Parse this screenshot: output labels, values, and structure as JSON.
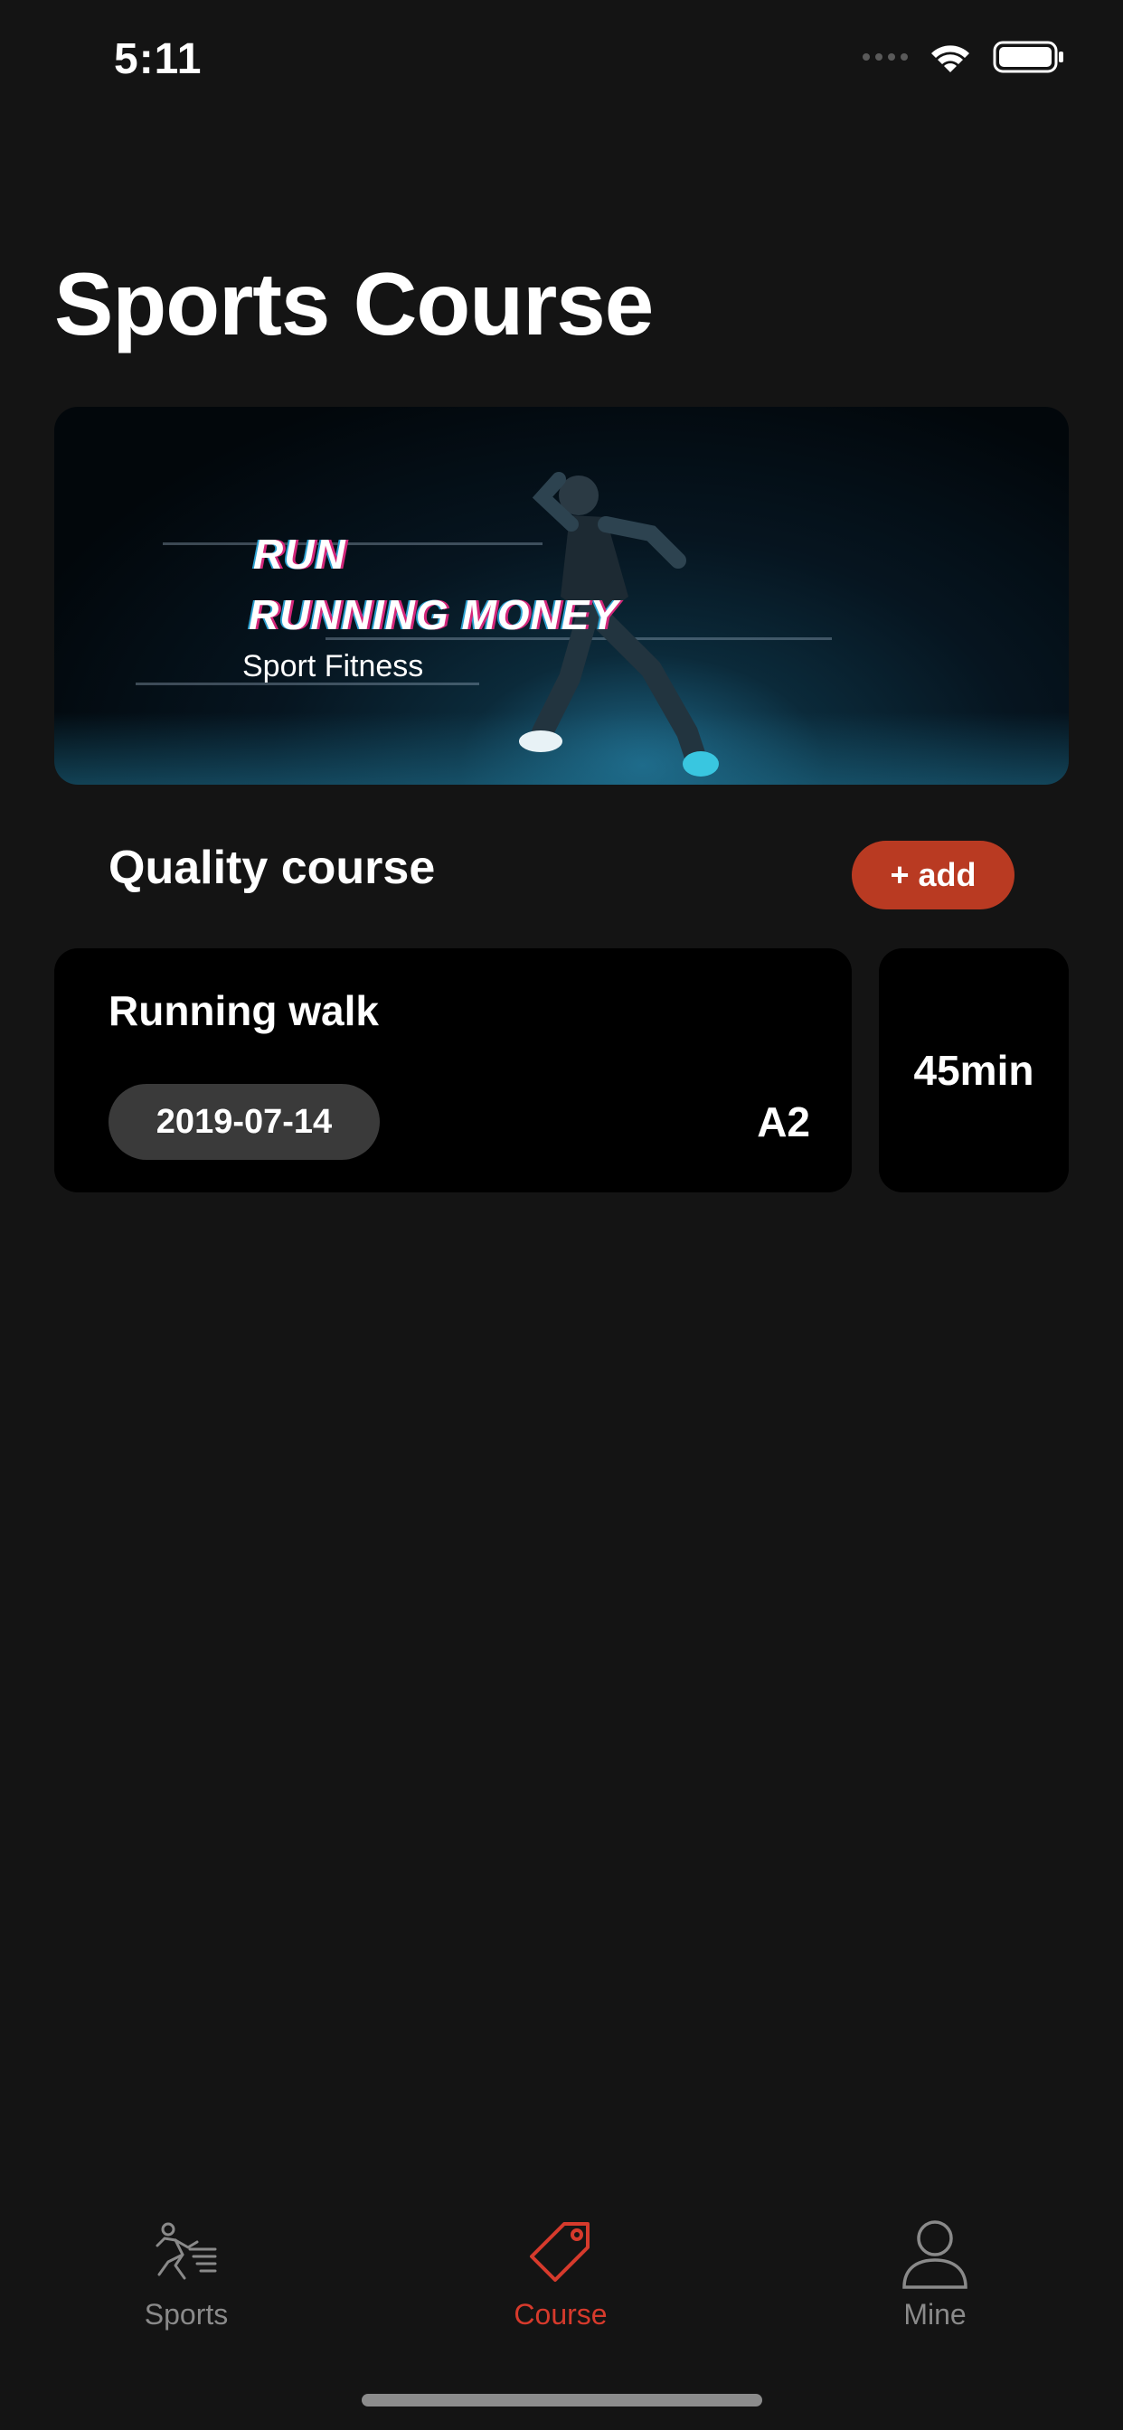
{
  "status_bar": {
    "time": "5:11",
    "wifi_icon": "wifi-icon",
    "battery_icon": "battery-icon"
  },
  "page": {
    "title": "Sports Course"
  },
  "banner": {
    "line1": "RUN",
    "line2": "RUNNING MONEY",
    "subtitle": "Sport Fitness"
  },
  "section": {
    "title": "Quality course",
    "add_label": "+ add"
  },
  "courses": [
    {
      "name": "Running walk",
      "date": "2019-07-14",
      "level": "A2",
      "duration": "45min"
    }
  ],
  "tabs": [
    {
      "label": "Sports",
      "icon": "runner-icon",
      "active": false
    },
    {
      "label": "Course",
      "icon": "tag-icon",
      "active": true
    },
    {
      "label": "Mine",
      "icon": "person-icon",
      "active": false
    }
  ],
  "colors": {
    "background": "#141414",
    "card": "#000000",
    "accent": "#b93a22",
    "tab_active": "#d63a2c",
    "tab_inactive": "#8a8a8a"
  }
}
